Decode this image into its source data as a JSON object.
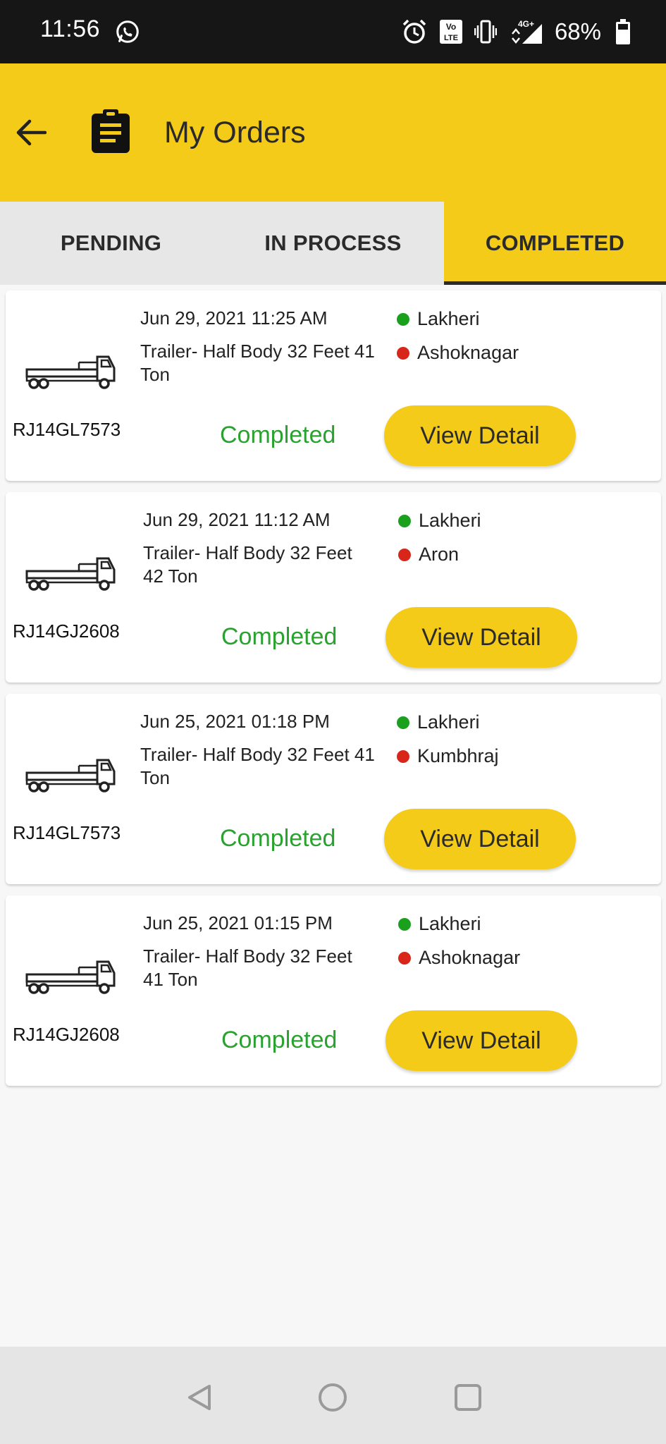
{
  "status_bar": {
    "time": "11:56",
    "battery": "68%",
    "icons": [
      "whatsapp-icon",
      "alarm-icon",
      "volte-icon",
      "vibrate-icon",
      "signal-4g-icon",
      "battery-icon"
    ]
  },
  "app_bar": {
    "title": "My Orders",
    "icons": [
      "back-arrow-icon",
      "clipboard-icon"
    ],
    "background_color": "#f5cb1a"
  },
  "tabs": [
    {
      "label": "PENDING",
      "active": false
    },
    {
      "label": "IN PROCESS",
      "active": false
    },
    {
      "label": "COMPLETED",
      "active": true
    }
  ],
  "orders": [
    {
      "date": "Jun 29, 2021 11:25 AM",
      "truck_type": "Trailer- Half Body 32 Feet 41 Ton",
      "vehicle_no": "RJ14GL7573",
      "from": "Lakheri",
      "to": "Ashoknagar",
      "status": "Completed",
      "action": "View Detail"
    },
    {
      "date": "Jun 29, 2021 11:12 AM",
      "truck_type": "Trailer- Half Body 32 Feet 42 Ton",
      "vehicle_no": "RJ14GJ2608",
      "from": "Lakheri",
      "to": "Aron",
      "status": "Completed",
      "action": "View Detail"
    },
    {
      "date": "Jun 25, 2021 01:18 PM",
      "truck_type": "Trailer- Half Body 32 Feet 41 Ton",
      "vehicle_no": "RJ14GL7573",
      "from": "Lakheri",
      "to": "Kumbhraj",
      "status": "Completed",
      "action": "View Detail"
    },
    {
      "date": "Jun 25, 2021 01:15 PM",
      "truck_type": "Trailer- Half Body 32 Feet 41 Ton",
      "vehicle_no": "RJ14GJ2608",
      "from": "Lakheri",
      "to": "Ashoknagar",
      "status": "Completed",
      "action": "View Detail"
    }
  ],
  "colors": {
    "accent": "#f5cb1a",
    "status_completed": "#2aa22f",
    "origin_dot": "#1aa01c",
    "destination_dot": "#d8261a"
  },
  "nav_bar": {
    "icons": [
      "nav-back-icon",
      "nav-home-icon",
      "nav-recents-icon"
    ]
  }
}
